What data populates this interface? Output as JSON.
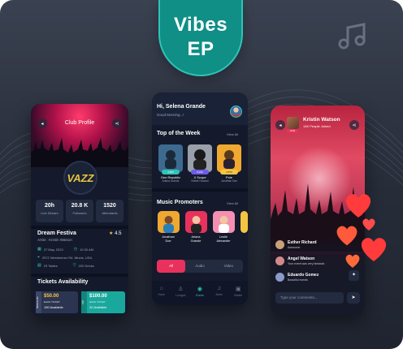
{
  "brand": {
    "line1": "Vibes",
    "line2": "EP",
    "accent": "#0f8f86"
  },
  "icons": {
    "decor": "music-note-icon",
    "back": "back-arrow-icon",
    "share": "share-icon"
  },
  "club": {
    "header_title": "Club Profile",
    "logo_text": "VAZZ",
    "stats": [
      {
        "value": "20h",
        "label": "Live Stream"
      },
      {
        "value": "20.8 K",
        "label": "Followers"
      },
      {
        "value": "1520",
        "label": "Attendants"
      }
    ],
    "event_name": "Dream Festiva",
    "rating": "4.5",
    "artist": "Artist : Kristin Watson",
    "date": "27 May, 2023",
    "time": "10:30 AM",
    "address": "2972 Westheimer Rd. Illinois, USA",
    "tables": "29 Tables",
    "drinks": "200 Drinks",
    "tickets_title": "Tickets Availability",
    "tickets": [
      {
        "tag": "REGULAR",
        "price": "$50.00",
        "sub": "EACH TICKET",
        "available": "150 Available"
      },
      {
        "tag": "VIP",
        "price": "$100.00",
        "sub": "EACH TICKET",
        "available": "20 Available"
      }
    ]
  },
  "home": {
    "greeting": "Hi, Selena Grande",
    "subgreeting": "Good Morning...!",
    "top_week_title": "Top of the Week",
    "view_all": "View All",
    "albums": [
      {
        "tag": "4,500",
        "title": "One Republic",
        "sub": "Ariana Grande",
        "tag_color": "#2ec4b6",
        "bg": "#3c6b8f"
      },
      {
        "tag": "8,200",
        "title": "X Scope",
        "sub": "Esther Howard",
        "tag_color": "#6c5ce7",
        "bg": "#9aa0aa"
      },
      {
        "tag": "4,570",
        "title": "Pole",
        "sub": "Jonathan Doe",
        "tag_color": "#f4c542",
        "bg": "#f0a830"
      }
    ],
    "promoters_title": "Music Promoters",
    "promoters": [
      {
        "first": "Jonathan",
        "last": "Doe",
        "bg": "#f0a830"
      },
      {
        "first": "Ariana",
        "last": "Grande",
        "bg": "#e8315d"
      },
      {
        "first": "Leslie",
        "last": "Alexander",
        "bg": "#f48fb1"
      }
    ],
    "segments": [
      "All",
      "Audio",
      "Video"
    ],
    "tabs": [
      "Home",
      "Lounges",
      "Events",
      "Alerts",
      "Market"
    ]
  },
  "live": {
    "host_name": "Kristin Watson",
    "host_sub": "14K People Joined",
    "live_label": "LIVE",
    "comments": [
      {
        "name": "Esther Richard",
        "text": "Awesome",
        "avatar": "#c8a07a"
      },
      {
        "name": "Angel Watson",
        "text": "Your event was very fantastic",
        "avatar": "#d08a8a"
      },
      {
        "name": "Eduardo Gomez",
        "text": "Beautiful events",
        "avatar": "#8a9ac8"
      }
    ],
    "comment_placeholder": "Type your comments...",
    "heart_color": "#ff3b3b"
  }
}
